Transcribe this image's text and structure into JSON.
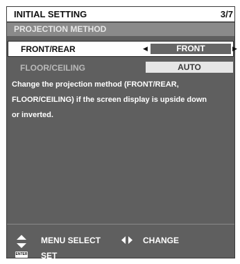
{
  "header": {
    "title": "INITIAL SETTING",
    "page": "3/7"
  },
  "section": {
    "title": "PROJECTION METHOD"
  },
  "rows": [
    {
      "label": "FRONT/REAR",
      "value": "FRONT"
    },
    {
      "label": "FLOOR/CEILING",
      "value": "AUTO"
    }
  ],
  "description": {
    "line1": "Change the projection method (FRONT/REAR,",
    "line2": "FLOOR/CEILING) if the screen display is upside down",
    "line3": "or inverted."
  },
  "footer": {
    "menu_select": "MENU SELECT",
    "change": "CHANGE",
    "enter_key": "ENTER",
    "set": "SET"
  },
  "icons": {
    "up_down": "updown-arrows-icon",
    "left_right": "leftright-arrows-icon",
    "enter": "enter-key-icon"
  }
}
